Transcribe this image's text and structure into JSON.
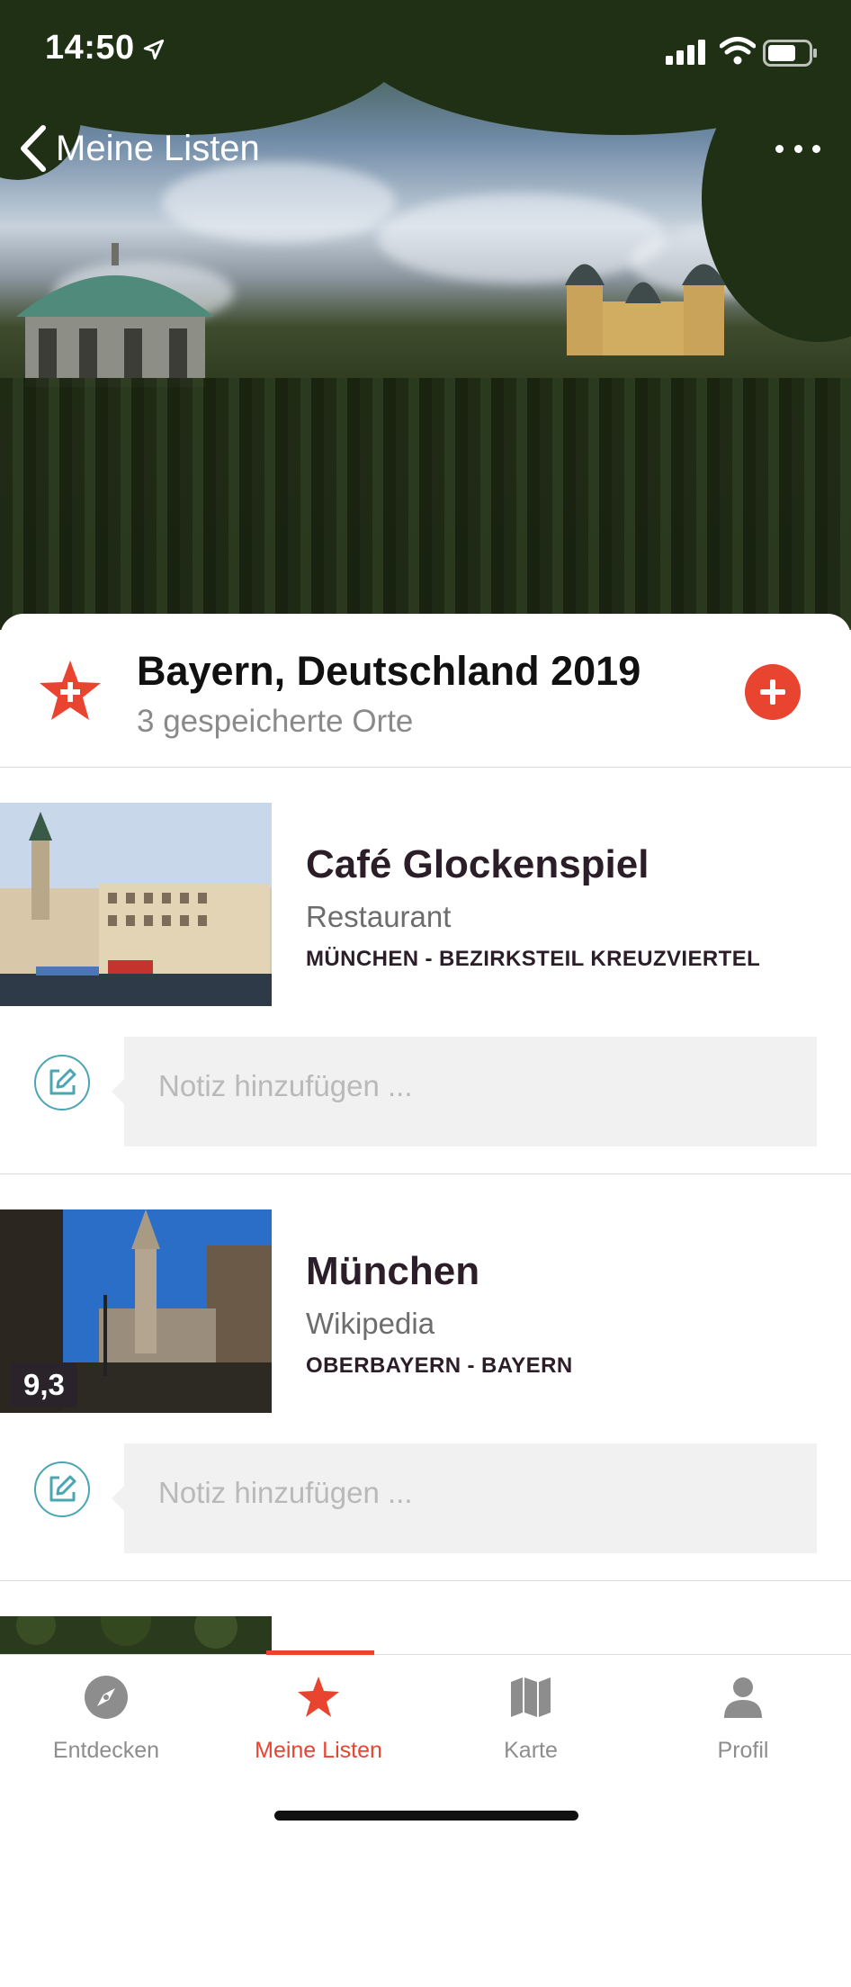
{
  "status_bar": {
    "time": "14:50"
  },
  "nav": {
    "back_label": "Meine Listen"
  },
  "list": {
    "title": "Bayern, Deutschland 2019",
    "subtitle": "3 gespeicherte Orte"
  },
  "places": [
    {
      "name": "Café Glockenspiel",
      "category": "Restaurant",
      "region": "MÜNCHEN - BEZIRKSTEIL KREUZVIERTEL",
      "note_placeholder": "Notiz hinzufügen ..."
    },
    {
      "name": "München",
      "category": "Wikipedia",
      "region": "OBERBAYERN - BAYERN",
      "score": "9,3",
      "note_placeholder": "Notiz hinzufügen ..."
    }
  ],
  "tabs": [
    {
      "label": "Entdecken",
      "icon": "compass-icon"
    },
    {
      "label": "Meine Listen",
      "icon": "star-icon"
    },
    {
      "label": "Karte",
      "icon": "map-icon"
    },
    {
      "label": "Profil",
      "icon": "person-icon"
    }
  ],
  "colors": {
    "accent": "#e8442f",
    "note_icon": "#4aa6b2",
    "title": "#2c1e28"
  }
}
